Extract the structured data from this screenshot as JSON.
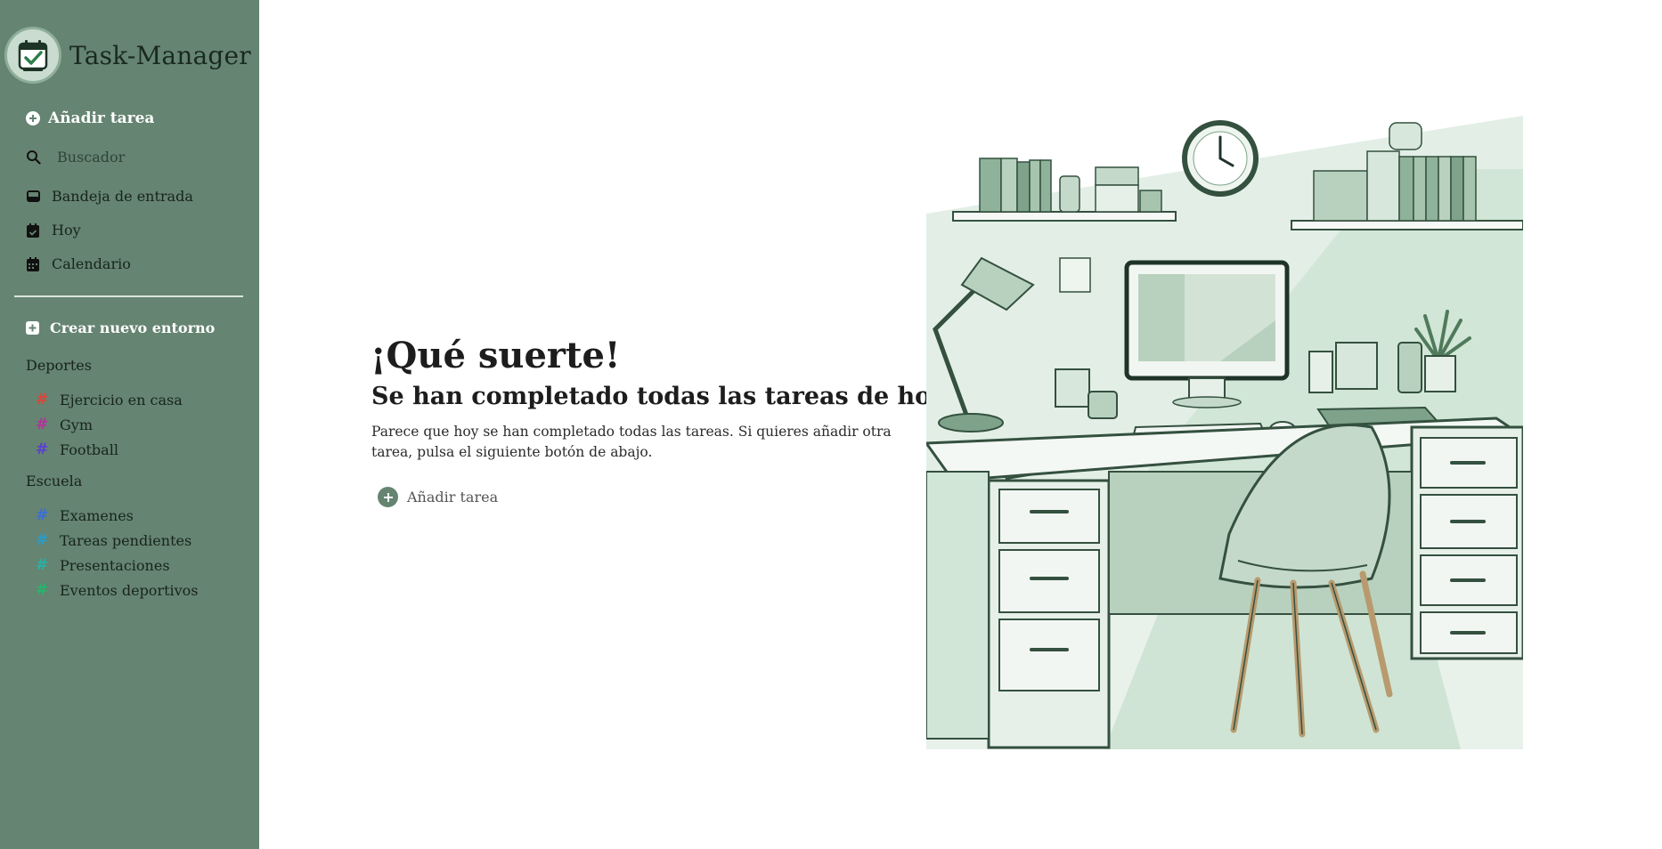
{
  "brand": {
    "title": "Task-Manager"
  },
  "sidebar": {
    "add_task_label": "Añadir tarea",
    "search_placeholder": "Buscador",
    "nav": [
      {
        "label": "Bandeja de entrada",
        "icon": "inbox-icon"
      },
      {
        "label": "Hoy",
        "icon": "calendar-check-icon"
      },
      {
        "label": "Calendario",
        "icon": "calendar-icon"
      }
    ],
    "create_env_label": "Crear nuevo entorno",
    "groups": [
      {
        "title": "Deportes",
        "projects": [
          {
            "label": "Ejercicio en casa",
            "color": "#d9453a"
          },
          {
            "label": "Gym",
            "color": "#b2339a"
          },
          {
            "label": "Football",
            "color": "#5a3fd2"
          }
        ]
      },
      {
        "title": "Escuela",
        "projects": [
          {
            "label": "Examenes",
            "color": "#3b6fd9"
          },
          {
            "label": "Tareas pendientes",
            "color": "#2a9bc7"
          },
          {
            "label": "Presentaciones",
            "color": "#2ab0a5"
          },
          {
            "label": "Eventos deportivos",
            "color": "#25b56c"
          }
        ]
      }
    ]
  },
  "main": {
    "title": "¡Qué suerte!",
    "subtitle": "Se han completado todas las tareas de hoy.",
    "description": "Parece que hoy se han completado todas las tareas. Si quieres añadir otra tarea, pulsa el siguiente botón de abajo.",
    "add_task_label": "Añadir tarea"
  },
  "colors": {
    "sidebar_bg": "#658471",
    "accent": "#658471"
  }
}
